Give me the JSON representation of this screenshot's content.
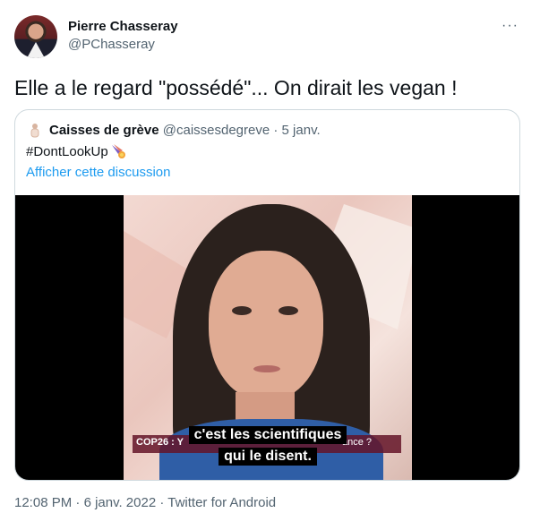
{
  "author": {
    "name": "Pierre Chasseray",
    "handle": "@PChasseray"
  },
  "more_label": "···",
  "tweet_text": "Elle a le regard \"possédé\"... On dirait les vegan !",
  "quoted": {
    "name": "Caisses de grève",
    "handle": "@caissesdegreve",
    "separator": " · ",
    "date": "5 janv.",
    "text": "#DontLookUp",
    "emoji_icon": "comet-icon",
    "show_thread": "Afficher cette discussion",
    "video": {
      "banner": "COP26 : Y",
      "banner_tail": "ance ?",
      "subtitle_line1": "c'est les scientifiques",
      "subtitle_line2": "qui le disent."
    }
  },
  "footer": {
    "time": "12:08 PM",
    "separator": " · ",
    "date": "6 janv. 2022",
    "separator2": " · ",
    "source": "Twitter for Android"
  },
  "colors": {
    "link": "#1d9bf0",
    "secondary_text": "#536471",
    "border": "#cfd9de"
  }
}
